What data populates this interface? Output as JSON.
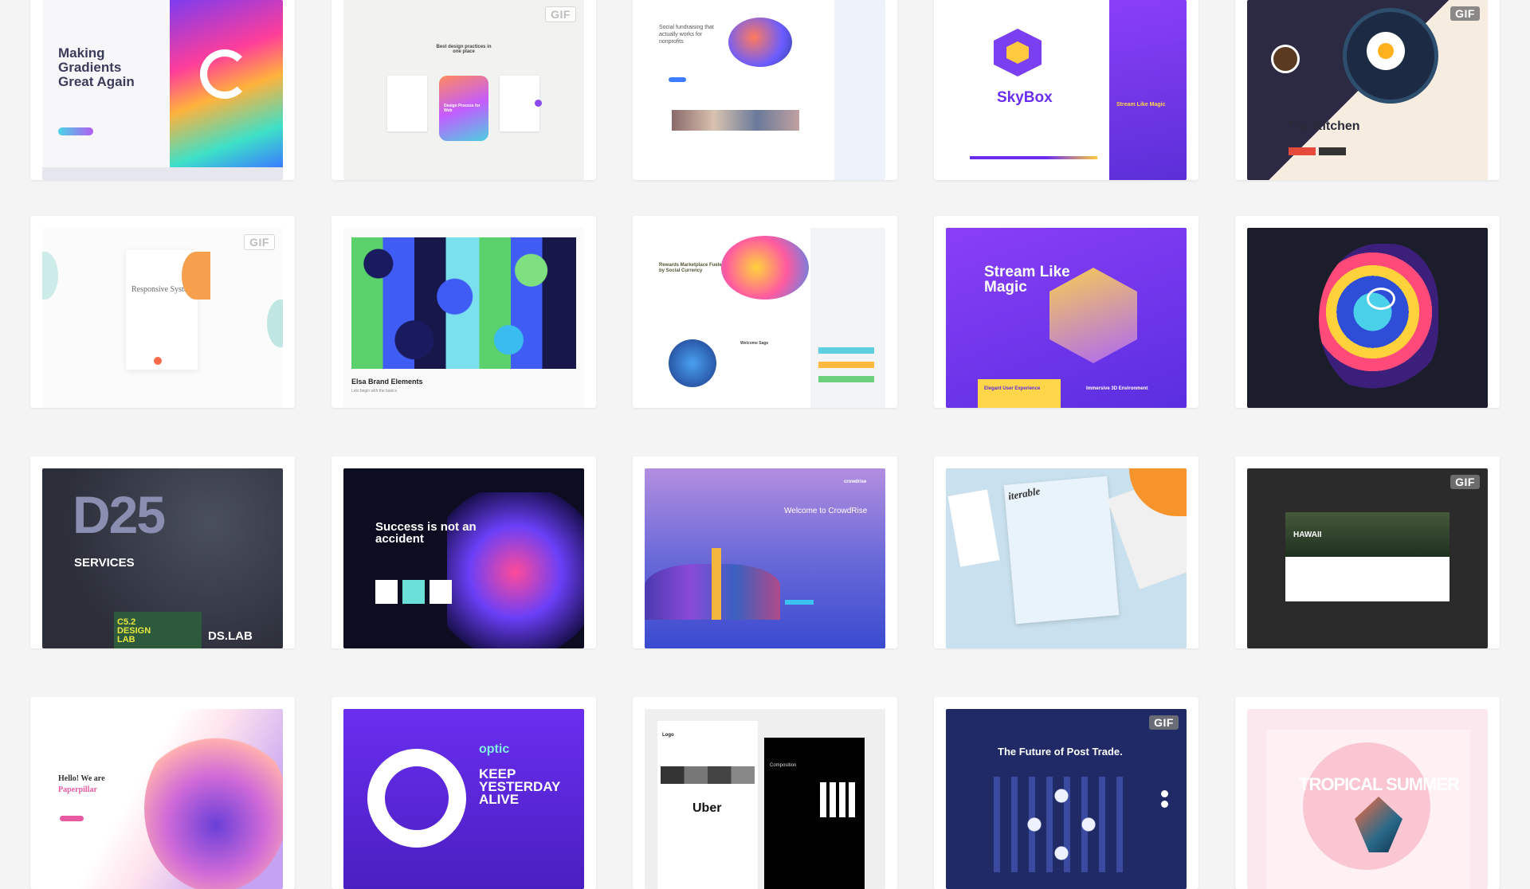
{
  "gif_label": "GIF",
  "shots": [
    {
      "name": "making-gradients",
      "title": "Making Gradients Great Again"
    },
    {
      "name": "design-practices",
      "title": "Best design practices in one place",
      "sub": "Design Process for Web"
    },
    {
      "name": "fundraising",
      "title": "Social fundraising that actually works for nonprofits"
    },
    {
      "name": "skybox",
      "title": "SkyBox",
      "sub": "Stream Like Magic"
    },
    {
      "name": "the-kitchen",
      "title": "The Kitchen"
    },
    {
      "name": "responsive-system",
      "title": "Responsive System"
    },
    {
      "name": "elsa-brand",
      "title": "Elsa Brand Elements",
      "sub": "Lets begin with the basics"
    },
    {
      "name": "rewards-marketplace",
      "title": "Rewards Marketplace Fueled by Social Currency",
      "sub": "Welcome Sage"
    },
    {
      "name": "stream-like-magic",
      "title": "Stream Like Magic",
      "sub": "Elegant User Experience",
      "sub2": "Immersive 3D Environment"
    },
    {
      "name": "portrait-illustration",
      "title": ""
    },
    {
      "name": "d25-services",
      "title": "D25",
      "sub": "SERVICES",
      "sub2": "DS.LAB",
      "sub3": "C5.2 DESIGN LAB"
    },
    {
      "name": "success-accident",
      "title": "Success is not an accident"
    },
    {
      "name": "crowdrise",
      "title": "Welcome to CrowdRise",
      "sub": "crowdrise"
    },
    {
      "name": "iterable",
      "title": "iterable"
    },
    {
      "name": "hawaii",
      "title": "HAWAII"
    },
    {
      "name": "paperpillar",
      "title": "Hello! We are",
      "sub": "Paperpillar"
    },
    {
      "name": "optic",
      "title": "optic",
      "sub": "KEEP YESTERDAY ALIVE"
    },
    {
      "name": "uber",
      "title": "Uber",
      "sub": "Logo",
      "sub2": "Composition"
    },
    {
      "name": "post-trade",
      "title": "The Future of Post Trade."
    },
    {
      "name": "tropical-summer",
      "title": "TROPICAL SUMMER"
    }
  ]
}
